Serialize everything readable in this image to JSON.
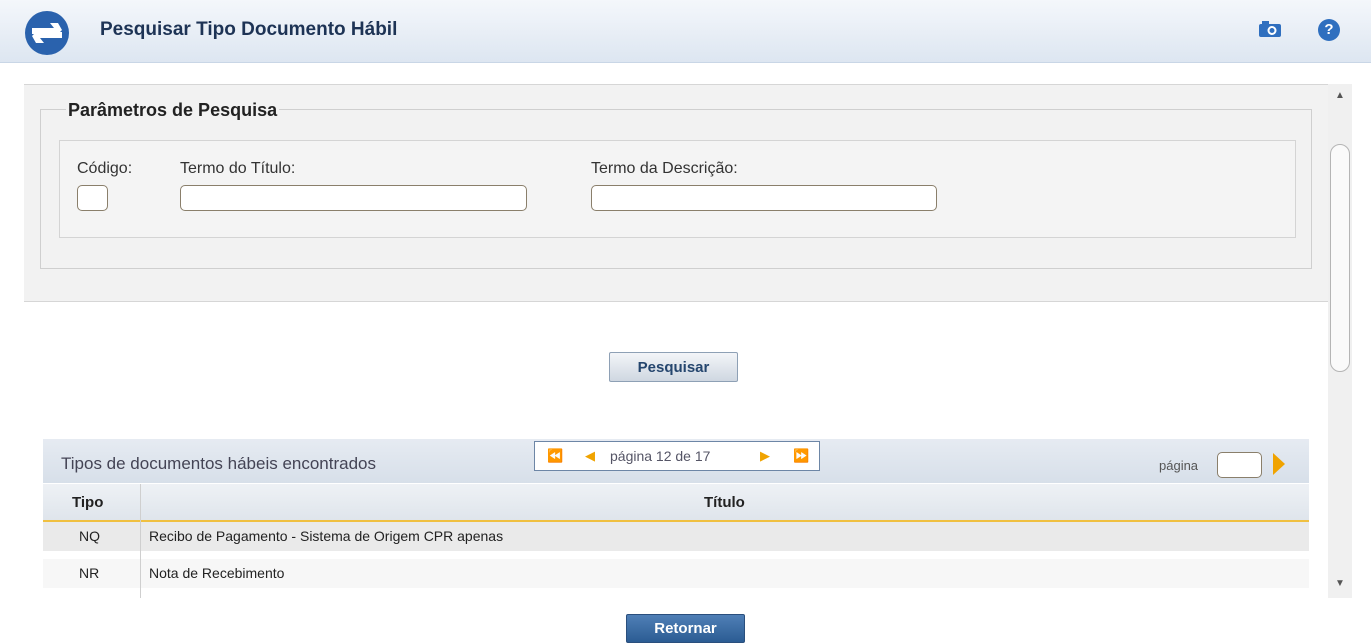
{
  "header": {
    "title": "Pesquisar Tipo Documento Hábil",
    "camera_icon": "camera-icon",
    "help_icon": "help-icon",
    "help_glyph": "?"
  },
  "params": {
    "legend": "Parâmetros de Pesquisa",
    "codigo_label": "Código:",
    "codigo_value": "",
    "titulo_label": "Termo do Título:",
    "titulo_value": "",
    "descricao_label": "Termo da Descrição:",
    "descricao_value": ""
  },
  "search_button": "Pesquisar",
  "results": {
    "title": "Tipos de documentos hábeis encontrados",
    "pager": {
      "first": "⏪",
      "prev": "◀",
      "text": "página 12 de 17",
      "next": "▶",
      "last": "⏩"
    },
    "page_label": "página",
    "page_value": "",
    "columns": [
      "Tipo",
      "Título"
    ],
    "rows": [
      {
        "tipo": "NQ",
        "titulo": "Recibo de Pagamento - Sistema de Origem CPR apenas"
      },
      {
        "tipo": "NR",
        "titulo": "Nota de Recebimento"
      }
    ]
  },
  "back_button": "Retornar",
  "colors": {
    "accent": "#f0a300",
    "header_title": "#1d3355",
    "back_button": "#2b5c93"
  }
}
